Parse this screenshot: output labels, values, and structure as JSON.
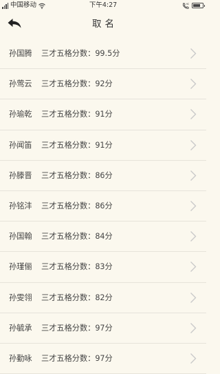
{
  "status_bar": {
    "carrier": "中国移动",
    "time": "下午4:27",
    "icons": [
      "signal-icon",
      "wifi-icon",
      "phone-icon",
      "battery-icon"
    ],
    "battery_level": 0.8
  },
  "nav": {
    "title": "取名",
    "back_icon": "back-arrow-icon"
  },
  "list": {
    "items": [
      {
        "name": "孙国腾",
        "score_text": "三才五格分数：99.5分"
      },
      {
        "name": "孙莺云",
        "score_text": "三才五格分数：92分"
      },
      {
        "name": "孙瑜乾",
        "score_text": "三才五格分数：91分"
      },
      {
        "name": "孙闻笛",
        "score_text": "三才五格分数：91分"
      },
      {
        "name": "孙滕晋",
        "score_text": "三才五格分数：86分"
      },
      {
        "name": "孙铭沣",
        "score_text": "三才五格分数：86分"
      },
      {
        "name": "孙国翰",
        "score_text": "三才五格分数：84分"
      },
      {
        "name": "孙瑾俪",
        "score_text": "三才五格分数：83分"
      },
      {
        "name": "孙雯翎",
        "score_text": "三才五格分数：82分"
      },
      {
        "name": "孙毓承",
        "score_text": "三才五格分数：97分"
      },
      {
        "name": "孙勤咏",
        "score_text": "三才五格分数：97分"
      }
    ],
    "chevron_icon": "chevron-right-icon"
  },
  "colors": {
    "background": "#fbf8ee",
    "divider": "#e6e3da",
    "text": "#444444",
    "chevron": "#c8c8c8"
  }
}
